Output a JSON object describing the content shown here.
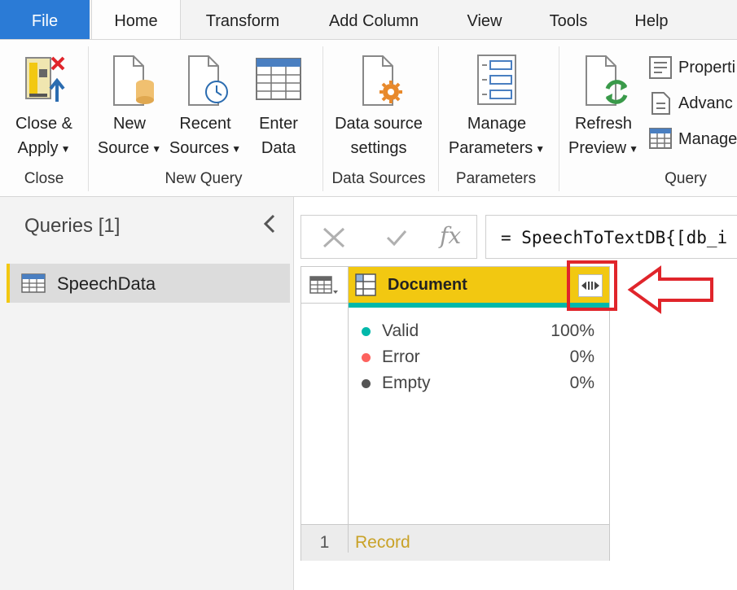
{
  "tabs": [
    {
      "label": "File"
    },
    {
      "label": "Home"
    },
    {
      "label": "Transform"
    },
    {
      "label": "Add Column"
    },
    {
      "label": "View"
    },
    {
      "label": "Tools"
    },
    {
      "label": "Help"
    }
  ],
  "ribbon": {
    "close_apply": {
      "line1": "Close &",
      "line2": "Apply"
    },
    "new_source": {
      "line1": "New",
      "line2": "Source"
    },
    "recent_sources": {
      "line1": "Recent",
      "line2": "Sources"
    },
    "enter_data": {
      "line1": "Enter",
      "line2": "Data"
    },
    "data_source_settings": {
      "line1": "Data source",
      "line2": "settings"
    },
    "manage_parameters": {
      "line1": "Manage",
      "line2": "Parameters"
    },
    "refresh_preview": {
      "line1": "Refresh",
      "line2": "Preview"
    },
    "properties": "Properti",
    "advanced": "Advanc",
    "manage": "Manage",
    "groups": {
      "close": "Close",
      "new_query": "New Query",
      "data_sources": "Data Sources",
      "parameters": "Parameters",
      "query": "Query"
    }
  },
  "queries": {
    "title": "Queries [1]",
    "items": [
      {
        "label": "SpeechData"
      }
    ]
  },
  "formula_bar": {
    "fx": "fx",
    "formula": "= SpeechToTextDB{[db_i"
  },
  "grid": {
    "column": "Document",
    "quality": [
      {
        "name": "Valid",
        "value": "100%",
        "color": "#01b8aa"
      },
      {
        "name": "Error",
        "value": "0%",
        "color": "#fd625e"
      },
      {
        "name": "Empty",
        "value": "0%",
        "color": "#555555"
      }
    ],
    "rows": [
      {
        "num": "1",
        "value": "Record"
      }
    ]
  },
  "colors": {
    "accent": "#f2c811",
    "file_tab": "#2b7bd6",
    "annotation": "#e0252b"
  }
}
